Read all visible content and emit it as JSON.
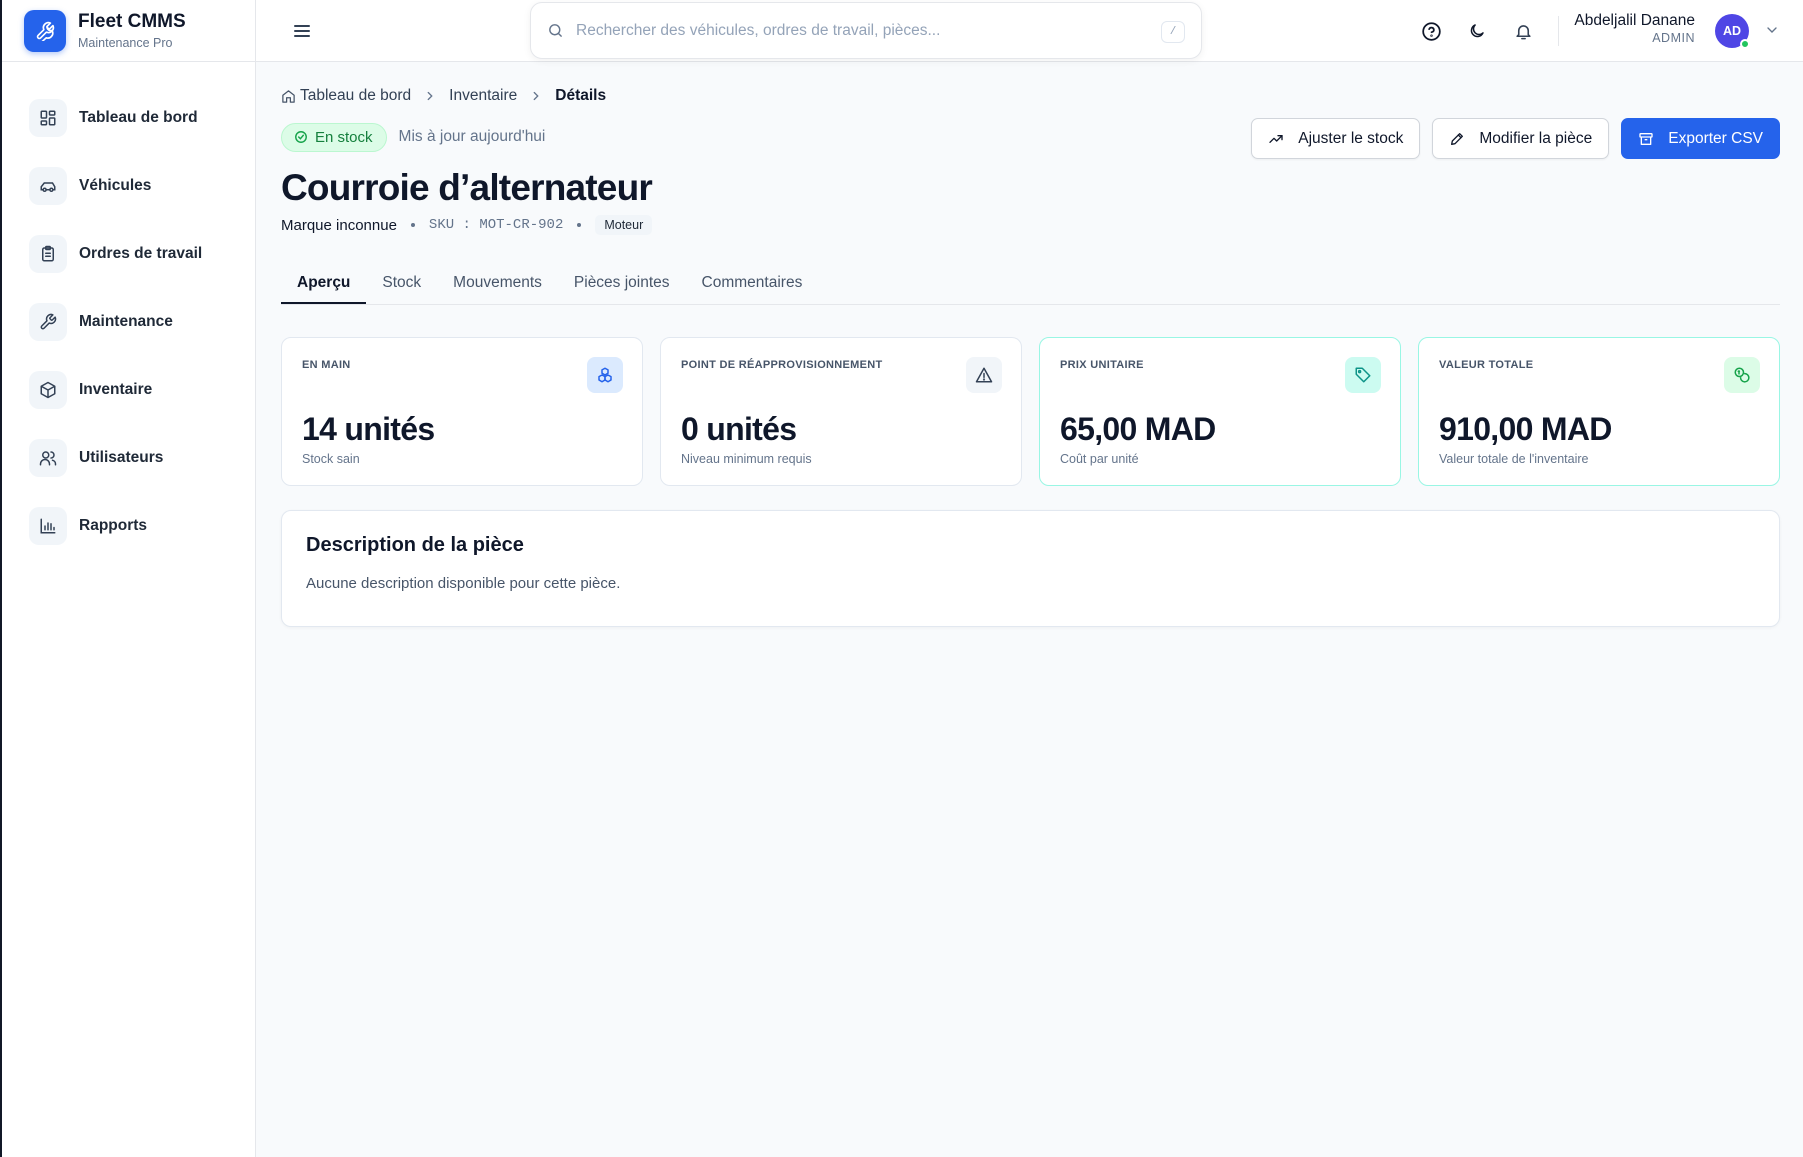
{
  "app": {
    "title": "Fleet CMMS",
    "subtitle": "Maintenance Pro"
  },
  "sidebar": {
    "items": [
      {
        "label": "Tableau de bord",
        "icon": "dashboard-icon"
      },
      {
        "label": "Véhicules",
        "icon": "car-icon"
      },
      {
        "label": "Ordres de travail",
        "icon": "clipboard-icon"
      },
      {
        "label": "Maintenance",
        "icon": "wrench-icon"
      },
      {
        "label": "Inventaire",
        "icon": "box-icon"
      },
      {
        "label": "Utilisateurs",
        "icon": "users-icon"
      },
      {
        "label": "Rapports",
        "icon": "bar-chart-icon"
      }
    ]
  },
  "header": {
    "search_placeholder": "Rechercher des véhicules, ordres de travail, pièces...",
    "search_shortcut": "/",
    "user": {
      "name": "Abdeljalil Danane",
      "role": "ADMIN",
      "initials": "AD"
    }
  },
  "breadcrumb": {
    "home": "Tableau de bord",
    "section": "Inventaire",
    "current": "Détails"
  },
  "part": {
    "status": "En stock",
    "updated": "Mis à jour aujourd'hui",
    "name": "Courroie d’alternateur",
    "brand": "Marque inconnue",
    "sku": "SKU : MOT-CR-902",
    "category": "Moteur"
  },
  "actions": {
    "adjust": "Ajuster le stock",
    "edit": "Modifier la pièce",
    "export": "Exporter CSV"
  },
  "tabs": [
    "Aperçu",
    "Stock",
    "Mouvements",
    "Pièces jointes",
    "Commentaires"
  ],
  "stats": [
    {
      "label": "EN MAIN",
      "value": "14 unités",
      "sub": "Stock sain",
      "icon": "stack-icon",
      "accent": "#2563eb"
    },
    {
      "label": "POINT DE RÉAPPROVISIONNEMENT",
      "value": "0 unités",
      "sub": "Niveau minimum requis",
      "icon": "warning-icon",
      "accent": "#334155"
    },
    {
      "label": "PRIX UNITAIRE",
      "value": "65,00 MAD",
      "sub": "Coût par unité",
      "icon": "tag-icon",
      "accent": "#0d9488"
    },
    {
      "label": "VALEUR TOTALE",
      "value": "910,00 MAD",
      "sub": "Valeur totale de l'inventaire",
      "icon": "coins-icon",
      "accent": "#16a34a"
    }
  ],
  "description": {
    "title": "Description de la pièce",
    "text": "Aucune description disponible pour cette pièce."
  }
}
